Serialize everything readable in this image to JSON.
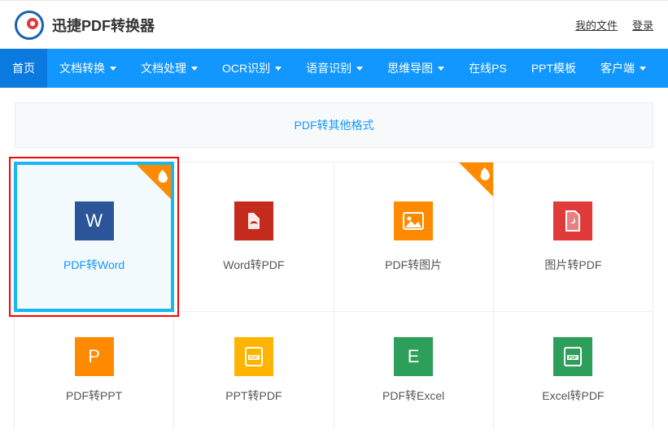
{
  "header": {
    "brand": "迅捷PDF转换器",
    "links": {
      "my_files": "我的文件",
      "login": "登录"
    }
  },
  "nav": {
    "items": [
      {
        "label": "首页",
        "dropdown": false,
        "active": true
      },
      {
        "label": "文档转换",
        "dropdown": true
      },
      {
        "label": "文档处理",
        "dropdown": true
      },
      {
        "label": "OCR识别",
        "dropdown": true
      },
      {
        "label": "语音识别",
        "dropdown": true
      },
      {
        "label": "思维导图",
        "dropdown": true
      },
      {
        "label": "在线PS",
        "dropdown": false
      },
      {
        "label": "PPT模板",
        "dropdown": false
      },
      {
        "label": "客户端",
        "dropdown": true
      }
    ]
  },
  "category_bar": {
    "label": "PDF转其他格式"
  },
  "cards": {
    "row1": [
      {
        "label": "PDF转Word",
        "hot": true,
        "selected": true,
        "icon": "w"
      },
      {
        "label": "Word转PDF",
        "hot": false,
        "icon": "pdf"
      },
      {
        "label": "PDF转图片",
        "hot": true,
        "icon": "img"
      },
      {
        "label": "图片转PDF",
        "hot": false,
        "icon": "imgpdf"
      }
    ],
    "row2": [
      {
        "label": "PDF转PPT",
        "icon": "p"
      },
      {
        "label": "PPT转PDF",
        "icon": "ppt"
      },
      {
        "label": "PDF转Excel",
        "icon": "e"
      },
      {
        "label": "Excel转PDF",
        "icon": "excel"
      }
    ]
  },
  "icon_text": {
    "w": "W",
    "p": "P",
    "e": "E"
  },
  "colors": {
    "primary": "#1296ff",
    "accent": "#ff8a00"
  }
}
